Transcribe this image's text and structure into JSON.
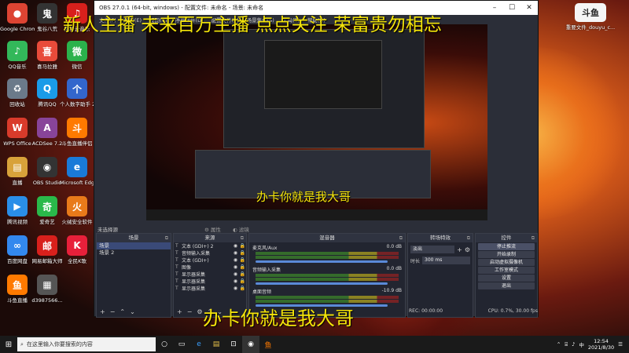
{
  "overlay": {
    "top_banner": "新人主播 未来百万主播 点点关注 荣富贵勿相忘",
    "mid_caption": "办卡你就是我大哥",
    "bottom_caption": "办卡你就是我大哥"
  },
  "desktop_icons": [
    {
      "label": "Google\nChrome",
      "glyph": "●",
      "color": "#dd4433"
    },
    {
      "label": "鬼谷八荒",
      "glyph": "鬼",
      "color": "#333333"
    },
    {
      "label": "QQ音乐",
      "glyph": "♪",
      "color": "#33b85a"
    },
    {
      "label": "喜马拉雅",
      "glyph": "喜",
      "color": "#e84b3a"
    },
    {
      "label": "网易云音乐",
      "glyph": "♫",
      "color": "#d8201c"
    },
    {
      "label": "回收站",
      "glyph": "♻",
      "color": "#6b7a8a"
    },
    {
      "label": "腾讯QQ",
      "glyph": "Q",
      "color": "#1a9be8"
    },
    {
      "label": "微信",
      "glyph": "微",
      "color": "#2bb24c"
    },
    {
      "label": "WPS Office",
      "glyph": "W",
      "color": "#d93b2b"
    },
    {
      "label": "ACDSee 7.2",
      "glyph": "A",
      "color": "#884499"
    },
    {
      "label": "个人数字助手 2.1",
      "glyph": "个",
      "color": "#3366cc"
    },
    {
      "label": "直播",
      "glyph": "▤",
      "color": "#d8a23a"
    },
    {
      "label": "OBS Studio",
      "glyph": "◉",
      "color": "#333333"
    },
    {
      "label": "斗鱼直播伴侣",
      "glyph": "斗",
      "color": "#ff7a00"
    },
    {
      "label": "腾讯视频",
      "glyph": "▶",
      "color": "#2a8ee8"
    },
    {
      "label": "爱奇艺",
      "glyph": "奇",
      "color": "#2ab94a"
    },
    {
      "label": "Microsoft Edge",
      "glyph": "e",
      "color": "#1a7ad8"
    },
    {
      "label": "百度网盘",
      "glyph": "∞",
      "color": "#3388ee"
    },
    {
      "label": "网易邮箱大师",
      "glyph": "邮",
      "color": "#d8201c"
    },
    {
      "label": "火绒安全软件",
      "glyph": "火",
      "color": "#e87a1a"
    },
    {
      "label": "斗鱼直播",
      "glyph": "鱼",
      "color": "#ff7a00"
    },
    {
      "label": "d3987566...",
      "glyph": "▦",
      "color": "#555555"
    },
    {
      "label": "全民K歌",
      "glyph": "K",
      "color": "#e8203a"
    }
  ],
  "right_icon": {
    "label": "重要文件_douyu_c..."
  },
  "obs": {
    "title": "OBS 27.0.1 (64-bit, windows) - 配置文件: 未命名 - 场景: 未命名",
    "menu": [
      "文件(F)",
      "编辑(E)",
      "视图(V)",
      "停靠部件(D)",
      "配置文件(P)",
      "场景集合(S)",
      "工具(T)",
      "帮助(H)"
    ],
    "status_label": "未选择源",
    "props_btn": "属性",
    "filter_btn": "滤镜",
    "scenes": {
      "header": "场景",
      "items": [
        "场景",
        "场景 2"
      ]
    },
    "sources": {
      "header": "来源",
      "items": [
        "文本 (GDI+) 2",
        "音频输入采集",
        "文本 (GDI+)",
        "图像",
        "显示器采集",
        "显示器采集",
        "显示器采集"
      ]
    },
    "mixer": {
      "header": "混音器",
      "channels": [
        {
          "name": "麦克风/Aux",
          "level": "0.0 dB"
        },
        {
          "name": "音频输入采集",
          "level": "0.0 dB"
        },
        {
          "name": "桌面音频",
          "level": "-10.9 dB"
        }
      ]
    },
    "transitions": {
      "header": "转场特效",
      "type": "淡出",
      "duration_label": "时长",
      "duration": "300 ms"
    },
    "controls": {
      "header": "控件",
      "buttons": [
        "停止推流",
        "开始录制",
        "启动虚拟摄像机",
        "工作室模式",
        "设置",
        "退出"
      ]
    },
    "statusbar": {
      "rec": "REC: 00:00:00",
      "cpu": "CPU: 0.7%, 30.00 fps"
    }
  },
  "taskbar": {
    "search_placeholder": "在这里输入你要搜索的内容",
    "time": "12:54",
    "date": "2021/8/30",
    "lang": "中"
  }
}
